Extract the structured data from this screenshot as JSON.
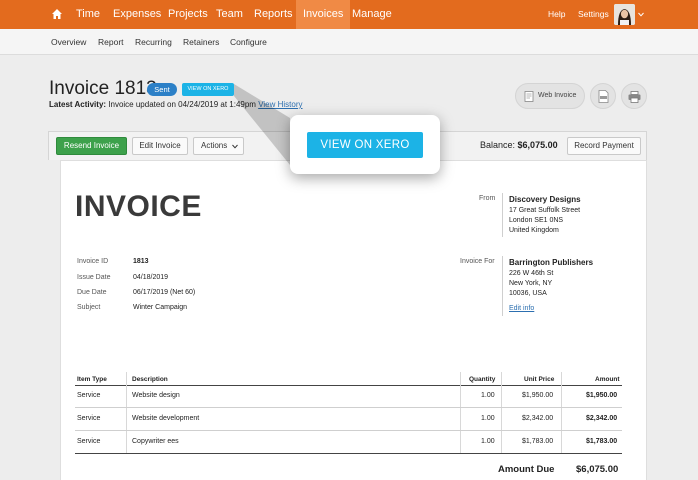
{
  "topnav": {
    "items": [
      "Time",
      "Expenses",
      "Projects",
      "Team",
      "Reports",
      "Invoices",
      "Manage"
    ],
    "active": "Invoices",
    "help": "Help",
    "settings": "Settings",
    "color": "#e36b1e"
  },
  "subnav": {
    "items": [
      "Overview",
      "Report",
      "Recurring",
      "Retainers",
      "Configure"
    ]
  },
  "header": {
    "title": "Invoice 1813",
    "status_badge": "Sent",
    "xero_badge": "VIEW ON XERO",
    "activity_label": "Latest Activity:",
    "activity_text": " Invoice updated on 04/24/2019 at 1:49pm ",
    "view_history": "View History",
    "web_invoice": "Web Invoice"
  },
  "toolbar": {
    "resend": "Resend Invoice",
    "edit": "Edit Invoice",
    "actions": "Actions",
    "balance_label": "Balance:",
    "balance_value": "$6,075.00",
    "record_payment": "Record Payment"
  },
  "invoice": {
    "heading": "INVOICE",
    "fields": [
      {
        "label": "Invoice ID",
        "value": "1813"
      },
      {
        "label": "Issue Date",
        "value": "04/18/2019"
      },
      {
        "label": "Due Date",
        "value": "06/17/2019 (Net 60)"
      },
      {
        "label": "Subject",
        "value": "Winter Campaign"
      }
    ],
    "from_label": "From",
    "from": {
      "name": "Discovery Designs",
      "lines": [
        "17 Great Suffolk Street",
        "London SE1 0NS",
        "United Kingdom"
      ]
    },
    "for_label": "Invoice For",
    "for": {
      "name": "Barrington Publishers",
      "lines": [
        "226 W 46th St",
        "New York, NY",
        "10036, USA"
      ],
      "edit": "Edit info"
    },
    "columns": [
      "Item Type",
      "Description",
      "Quantity",
      "Unit Price",
      "Amount"
    ],
    "rows": [
      [
        "Service",
        "Website design",
        "1.00",
        "$1,950.00",
        "$1,950.00"
      ],
      [
        "Service",
        "Website development",
        "1.00",
        "$2,342.00",
        "$2,342.00"
      ],
      [
        "Service",
        "Copywriter ees",
        "1.00",
        "$1,783.00",
        "$1,783.00"
      ]
    ],
    "amount_due_label": "Amount Due",
    "amount_due": "$6,075.00"
  },
  "callout": {
    "label": "VIEW ON XERO",
    "color": "#1cb3e6"
  }
}
